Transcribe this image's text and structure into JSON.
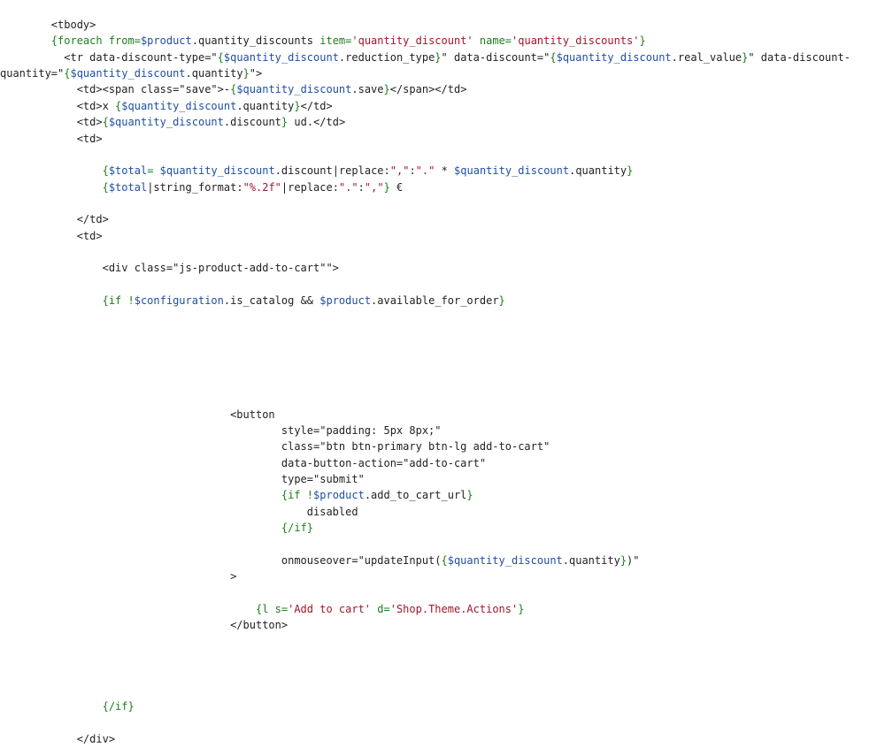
{
  "colors": {
    "background": "#ffffff",
    "plain": "#222222",
    "smarty": "#1a7f1a",
    "variable": "#1f4fa3",
    "string": "#a0172a"
  },
  "code": {
    "lines": [
      [
        {
          "t": "p",
          "v": "        <tbody>"
        }
      ],
      [
        {
          "t": "p",
          "v": "        "
        },
        {
          "t": "s",
          "v": "{foreach from="
        },
        {
          "t": "v",
          "v": "$product"
        },
        {
          "t": "p",
          "v": ".quantity_discounts "
        },
        {
          "t": "s",
          "v": "item="
        },
        {
          "t": "r",
          "v": "'quantity_discount'"
        },
        {
          "t": "p",
          "v": " "
        },
        {
          "t": "s",
          "v": "name="
        },
        {
          "t": "r",
          "v": "'quantity_discounts'"
        },
        {
          "t": "s",
          "v": "}"
        }
      ],
      [
        {
          "t": "p",
          "v": "          <tr data-discount-type=\""
        },
        {
          "t": "s",
          "v": "{"
        },
        {
          "t": "v",
          "v": "$quantity_discount"
        },
        {
          "t": "p",
          "v": ".reduction_type"
        },
        {
          "t": "s",
          "v": "}"
        },
        {
          "t": "p",
          "v": "\" data-discount=\""
        },
        {
          "t": "s",
          "v": "{"
        },
        {
          "t": "v",
          "v": "$quantity_discount"
        },
        {
          "t": "p",
          "v": ".real_value"
        },
        {
          "t": "s",
          "v": "}"
        },
        {
          "t": "p",
          "v": "\" data-discount-"
        }
      ],
      [
        {
          "t": "p",
          "v": "quantity=\""
        },
        {
          "t": "s",
          "v": "{"
        },
        {
          "t": "v",
          "v": "$quantity_discount"
        },
        {
          "t": "p",
          "v": ".quantity"
        },
        {
          "t": "s",
          "v": "}"
        },
        {
          "t": "p",
          "v": "\">"
        }
      ],
      [
        {
          "t": "p",
          "v": "            <td><span class=\"save\">-"
        },
        {
          "t": "s",
          "v": "{"
        },
        {
          "t": "v",
          "v": "$quantity_discount"
        },
        {
          "t": "p",
          "v": ".save"
        },
        {
          "t": "s",
          "v": "}"
        },
        {
          "t": "p",
          "v": "</span></td>"
        }
      ],
      [
        {
          "t": "p",
          "v": "            <td>x "
        },
        {
          "t": "s",
          "v": "{"
        },
        {
          "t": "v",
          "v": "$quantity_discount"
        },
        {
          "t": "p",
          "v": ".quantity"
        },
        {
          "t": "s",
          "v": "}"
        },
        {
          "t": "p",
          "v": "</td>"
        }
      ],
      [
        {
          "t": "p",
          "v": "            <td>"
        },
        {
          "t": "s",
          "v": "{"
        },
        {
          "t": "v",
          "v": "$quantity_discount"
        },
        {
          "t": "p",
          "v": ".discount"
        },
        {
          "t": "s",
          "v": "}"
        },
        {
          "t": "p",
          "v": " ud.</td>"
        }
      ],
      [
        {
          "t": "p",
          "v": "            <td>"
        }
      ],
      [],
      [
        {
          "t": "p",
          "v": "                "
        },
        {
          "t": "s",
          "v": "{"
        },
        {
          "t": "v",
          "v": "$total"
        },
        {
          "t": "s",
          "v": "="
        },
        {
          "t": "p",
          "v": " "
        },
        {
          "t": "v",
          "v": "$quantity_discount"
        },
        {
          "t": "p",
          "v": ".discount|replace:"
        },
        {
          "t": "r",
          "v": "\",\""
        },
        {
          "t": "p",
          "v": ":"
        },
        {
          "t": "r",
          "v": "\".\""
        },
        {
          "t": "p",
          "v": " * "
        },
        {
          "t": "v",
          "v": "$quantity_discount"
        },
        {
          "t": "p",
          "v": ".quantity"
        },
        {
          "t": "s",
          "v": "}"
        }
      ],
      [
        {
          "t": "p",
          "v": "                "
        },
        {
          "t": "s",
          "v": "{"
        },
        {
          "t": "v",
          "v": "$total"
        },
        {
          "t": "p",
          "v": "|string_format:"
        },
        {
          "t": "r",
          "v": "\"%.2f\""
        },
        {
          "t": "p",
          "v": "|replace:"
        },
        {
          "t": "r",
          "v": "\".\""
        },
        {
          "t": "p",
          "v": ":"
        },
        {
          "t": "r",
          "v": "\",\""
        },
        {
          "t": "s",
          "v": "}"
        },
        {
          "t": "p",
          "v": " €"
        }
      ],
      [],
      [
        {
          "t": "p",
          "v": "            </td>"
        }
      ],
      [
        {
          "t": "p",
          "v": "            <td>"
        }
      ],
      [],
      [
        {
          "t": "p",
          "v": "                <div class=\"js-product-add-to-cart\"\">"
        }
      ],
      [],
      [
        {
          "t": "p",
          "v": "                "
        },
        {
          "t": "s",
          "v": "{if !"
        },
        {
          "t": "v",
          "v": "$configuration"
        },
        {
          "t": "p",
          "v": ".is_catalog && "
        },
        {
          "t": "v",
          "v": "$product"
        },
        {
          "t": "p",
          "v": ".available_for_order"
        },
        {
          "t": "s",
          "v": "}"
        }
      ],
      [],
      [],
      [],
      [],
      [],
      [],
      [
        {
          "t": "p",
          "v": "                                    <button"
        }
      ],
      [
        {
          "t": "p",
          "v": "                                            style=\"padding: 5px 8px;\""
        }
      ],
      [
        {
          "t": "p",
          "v": "                                            class=\"btn btn-primary btn-lg add-to-cart\""
        }
      ],
      [
        {
          "t": "p",
          "v": "                                            data-button-action=\"add-to-cart\""
        }
      ],
      [
        {
          "t": "p",
          "v": "                                            type=\"submit\""
        }
      ],
      [
        {
          "t": "p",
          "v": "                                            "
        },
        {
          "t": "s",
          "v": "{if !"
        },
        {
          "t": "v",
          "v": "$product"
        },
        {
          "t": "p",
          "v": ".add_to_cart_url"
        },
        {
          "t": "s",
          "v": "}"
        }
      ],
      [
        {
          "t": "p",
          "v": "                                                disabled"
        }
      ],
      [
        {
          "t": "p",
          "v": "                                            "
        },
        {
          "t": "s",
          "v": "{/if}"
        }
      ],
      [],
      [
        {
          "t": "p",
          "v": "                                            onmouseover=\"updateInput("
        },
        {
          "t": "s",
          "v": "{"
        },
        {
          "t": "v",
          "v": "$quantity_discount"
        },
        {
          "t": "p",
          "v": ".quantity"
        },
        {
          "t": "s",
          "v": "}"
        },
        {
          "t": "p",
          "v": ")\""
        }
      ],
      [
        {
          "t": "p",
          "v": "                                    >"
        }
      ],
      [],
      [
        {
          "t": "p",
          "v": "                                        "
        },
        {
          "t": "s",
          "v": "{l s="
        },
        {
          "t": "r",
          "v": "'Add to cart'"
        },
        {
          "t": "p",
          "v": " "
        },
        {
          "t": "s",
          "v": "d="
        },
        {
          "t": "r",
          "v": "'Shop.Theme.Actions'"
        },
        {
          "t": "s",
          "v": "}"
        }
      ],
      [
        {
          "t": "p",
          "v": "                                    </button>"
        }
      ],
      [],
      [],
      [],
      [],
      [
        {
          "t": "p",
          "v": "                "
        },
        {
          "t": "s",
          "v": "{/if}"
        }
      ],
      [],
      [
        {
          "t": "p",
          "v": "            </div>"
        }
      ]
    ]
  }
}
